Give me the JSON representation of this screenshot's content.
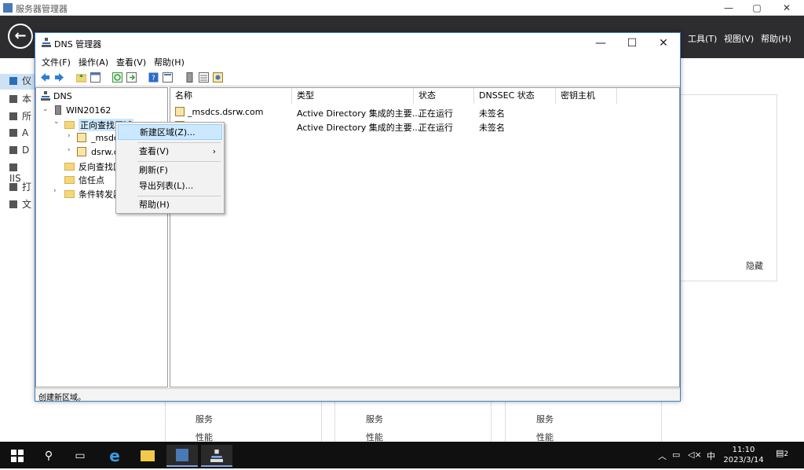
{
  "server_manager": {
    "title": "服务器管理器",
    "menu": [
      "工具(T)",
      "视图(V)",
      "帮助(H)"
    ],
    "nav": [
      "仪",
      "本",
      "所",
      "A",
      "D",
      "IIS",
      "打",
      "文"
    ],
    "hide": "隐藏",
    "bottom_items": [
      [
        "服务",
        "性能"
      ],
      [
        "服务",
        "性能"
      ],
      [
        "服务",
        "性能"
      ]
    ]
  },
  "dns": {
    "title": "DNS 管理器",
    "menu": [
      "文件(F)",
      "操作(A)",
      "查看(V)",
      "帮助(H)"
    ],
    "tree": {
      "root": "DNS",
      "server": "WIN20162",
      "forward": "正向查找区域",
      "zone1": "_msdc",
      "zone2": "dsrw.c",
      "reverse": "反向查找区",
      "trust": "信任点",
      "conditional": "条件转发器"
    },
    "columns": [
      "名称",
      "类型",
      "状态",
      "DNSSEC 状态",
      "密钥主机"
    ],
    "rows": [
      {
        "name": "_msdcs.dsrw.com",
        "type": "Active Directory 集成的主要...",
        "status": "正在运行",
        "dnssec": "未签名",
        "key": ""
      },
      {
        "name": "",
        "type": "Active Directory 集成的主要...",
        "status": "正在运行",
        "dnssec": "未签名",
        "key": ""
      }
    ],
    "status": "创建新区域。"
  },
  "context_menu": {
    "new_zone": "新建区域(Z)...",
    "view": "查看(V)",
    "refresh": "刷新(F)",
    "export": "导出列表(L)...",
    "help": "帮助(H)"
  },
  "taskbar": {
    "time": "11:10",
    "date": "2023/3/14",
    "ime": "中",
    "notif_count": "2"
  }
}
